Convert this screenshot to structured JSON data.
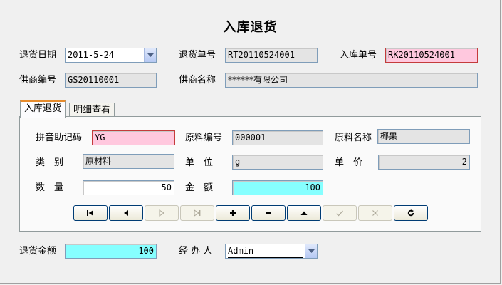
{
  "window": {
    "title": "入库退货"
  },
  "header": {
    "return_date_label": "退货日期",
    "return_date_value": "2011-5-24",
    "return_no_label": "退货单号",
    "return_no_value": "RT20110524001",
    "inbound_no_label": "入库单号",
    "inbound_no_value": "RK20110524001",
    "supplier_code_label": "供商编号",
    "supplier_code_value": "GS20110001",
    "supplier_name_label": "供商名称",
    "supplier_name_value": "******有限公司"
  },
  "tabs": [
    {
      "label": "入库退货",
      "active": true
    },
    {
      "label": "明细查看",
      "active": false
    }
  ],
  "detail": {
    "pinyin_label": "拼音助记码",
    "pinyin_value": "YG",
    "material_code_label": "原料编号",
    "material_code_value": "000001",
    "material_name_label": "原料名称",
    "material_name_value": "椰果",
    "category_label": "类　别",
    "category_value": "原材料",
    "unit_label": "单　位",
    "unit_value": "g",
    "price_label": "单　价",
    "price_value": "2",
    "quantity_label": "数　量",
    "quantity_value": "50",
    "amount_label": "金　额",
    "amount_value": "100"
  },
  "toolbar": {
    "buttons": [
      {
        "name": "first-record-button",
        "icon": "first-icon",
        "enabled": true
      },
      {
        "name": "previous-record-button",
        "icon": "previous-icon",
        "enabled": true
      },
      {
        "name": "next-record-button",
        "icon": "next-icon",
        "enabled": false
      },
      {
        "name": "last-record-button",
        "icon": "last-icon",
        "enabled": false
      },
      {
        "name": "add-record-button",
        "icon": "plus-icon",
        "enabled": true
      },
      {
        "name": "delete-record-button",
        "icon": "minus-icon",
        "enabled": true
      },
      {
        "name": "edit-record-button",
        "icon": "up-triangle-icon",
        "enabled": true
      },
      {
        "name": "post-record-button",
        "icon": "check-icon",
        "enabled": false
      },
      {
        "name": "cancel-record-button",
        "icon": "cross-icon",
        "enabled": false
      },
      {
        "name": "refresh-button",
        "icon": "refresh-icon",
        "enabled": true
      }
    ]
  },
  "footer": {
    "return_amount_label": "退货金额",
    "return_amount_value": "100",
    "handler_label": "经 办 人",
    "handler_value": "Admin"
  },
  "colors": {
    "highlight_pink": "#ffc8de",
    "highlight_cyan": "#86ffff",
    "readonly_gray": "#e4e4e4",
    "tab_accent": "#e68b2c"
  }
}
